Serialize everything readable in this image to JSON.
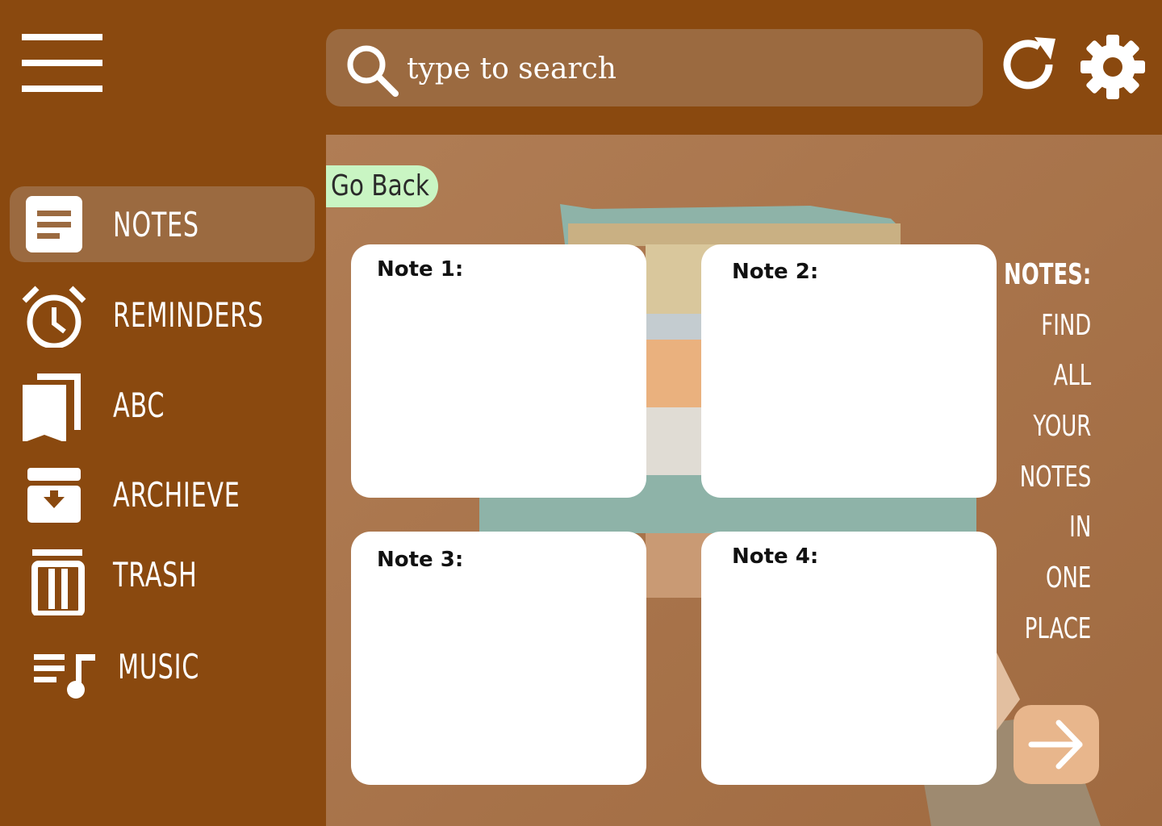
{
  "header": {
    "search_placeholder": "type to search"
  },
  "icons": {
    "menu": "hamburger-menu-icon",
    "search": "search-icon",
    "refresh": "refresh-icon",
    "settings": "gear-icon"
  },
  "sidebar": {
    "items": [
      {
        "label": "NOTES",
        "icon": "notes-icon",
        "active": true
      },
      {
        "label": "REMINDERS",
        "icon": "alarm-clock-icon",
        "active": false
      },
      {
        "label": "ABC",
        "icon": "bookmark-icon",
        "active": false
      },
      {
        "label": "ARCHIEVE",
        "icon": "archive-icon",
        "active": false
      },
      {
        "label": "TRASH",
        "icon": "trash-icon",
        "active": false
      },
      {
        "label": "MUSIC",
        "icon": "music-list-icon",
        "active": false
      }
    ]
  },
  "main": {
    "go_back_label": "Go Back",
    "notes": [
      {
        "title": "Note 1:"
      },
      {
        "title": "Note 2:"
      },
      {
        "title": "Note 3:"
      },
      {
        "title": "Note 4:"
      }
    ],
    "side_text": {
      "heading": "NOTES:",
      "words": [
        "FIND",
        "ALL",
        "YOUR",
        "NOTES",
        "IN",
        "ONE",
        "PLACE"
      ]
    },
    "next_icon": "arrow-right-icon"
  },
  "colors": {
    "background": "#8a490f",
    "active_item": "#9b6a40",
    "go_back": "#c9f5c3",
    "next_button": "#e8b68c"
  }
}
